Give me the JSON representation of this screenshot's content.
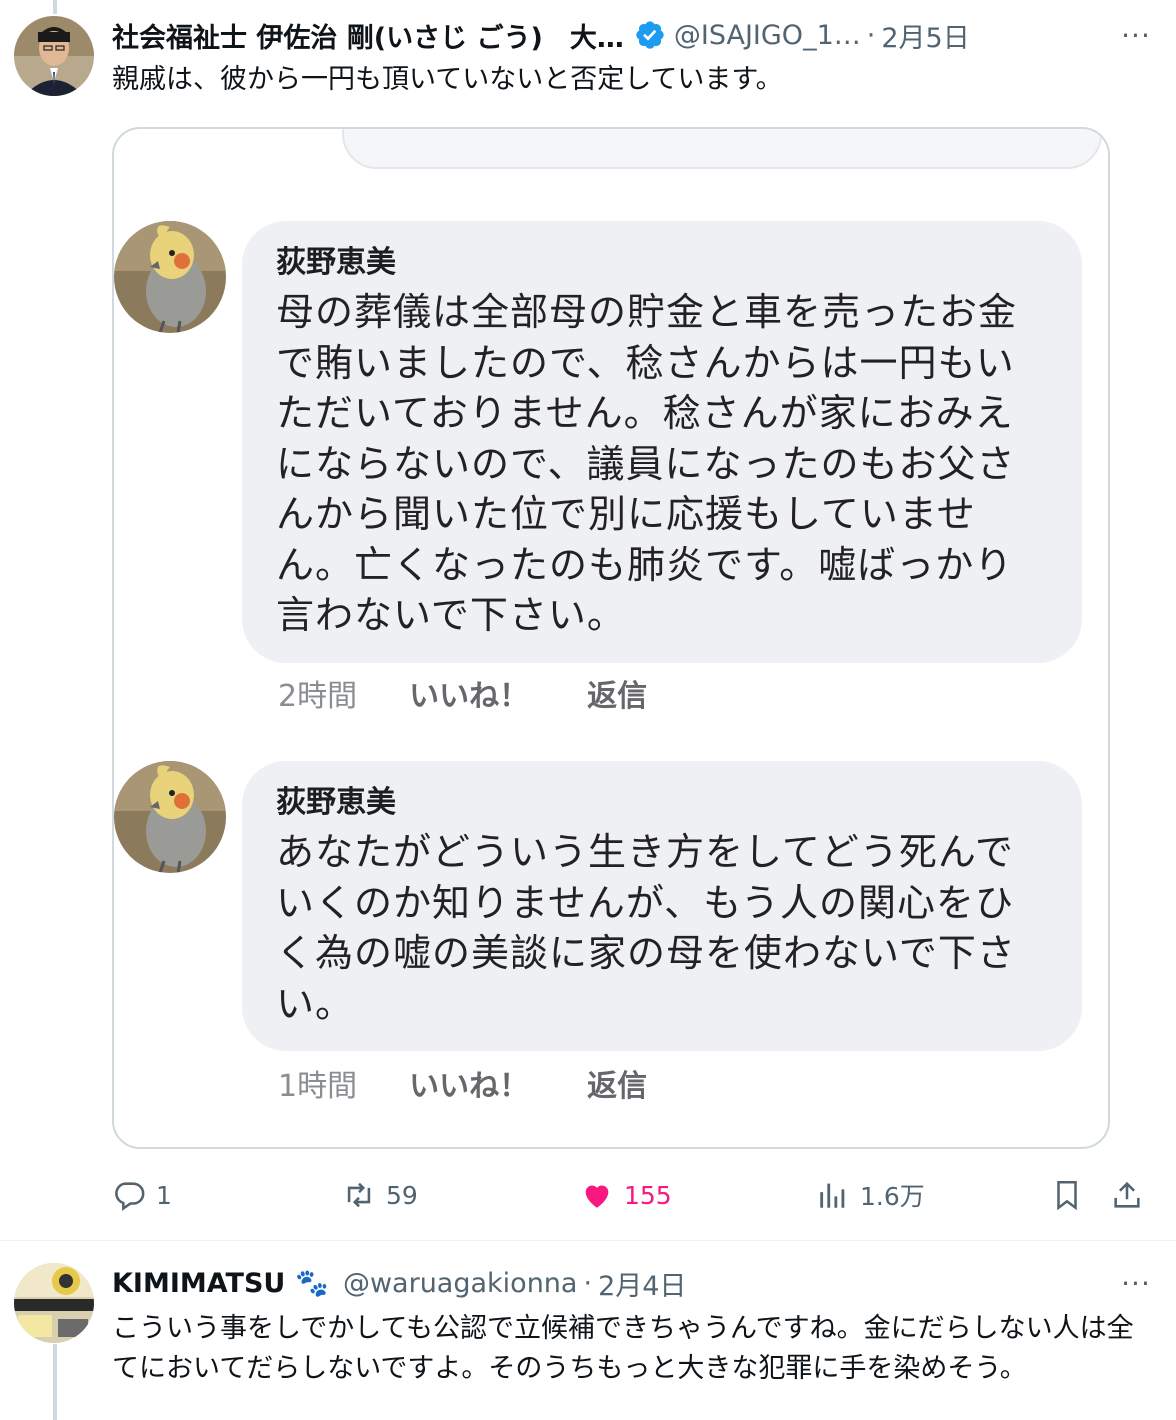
{
  "tweet1": {
    "display_name": "社会福祉士 伊佐治 剛(いさじ ごう)　大…",
    "handle": "@ISAJIGO_1…",
    "separator": "·",
    "date": "2月5日",
    "more": "···",
    "text": "親戚は、彼から一円も頂いていないと否定しています。",
    "embedded_comments": [
      {
        "name": "荻野恵美",
        "text": "母の葬儀は全部母の貯金と車を売ったお金で賄いましたので、稔さんからは一円もいただいておりません。稔さんが家におみえにならないので、議員になったのもお父さんから聞いた位で別に応援もしていません。亡くなったのも肺炎です。嘘ばっかり言わないで下さい。",
        "time": "2時間",
        "like": "いいね！",
        "reply": "返信"
      },
      {
        "name": "荻野恵美",
        "text": "あなたがどういう生き方をしてどう死んでいくのか知りませんが、もう人の関心をひく為の嘘の美談に家の母を使わないで下さい。",
        "time": "1時間",
        "like": "いいね！",
        "reply": "返信"
      }
    ],
    "actions": {
      "replies": "1",
      "retweets": "59",
      "likes": "155",
      "views": "1.6万"
    },
    "colors": {
      "like": "#f91880",
      "verified": "#1d9bf0",
      "muted": "#536471"
    }
  },
  "tweet2": {
    "display_name": "KIMIMATSU",
    "emoji": "🐾",
    "handle": "@waruagakionna",
    "separator": "·",
    "date": "2月4日",
    "more": "···",
    "text": "こういう事をしでかしても公認で立候補できちゃうんですね。金にだらしない人は全てにおいてだらしないですよ。そのうちもっと大きな犯罪に手を染めそう。"
  }
}
